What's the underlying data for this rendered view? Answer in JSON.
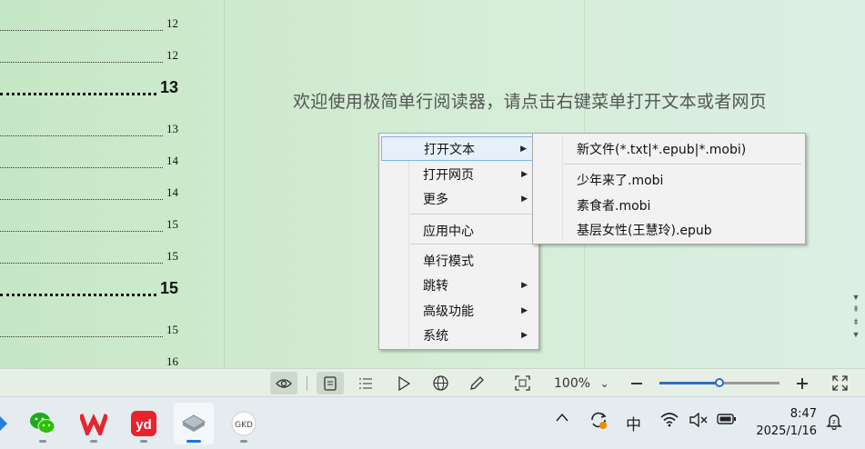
{
  "document": {
    "toc": [
      {
        "page": "12",
        "style": "small"
      },
      {
        "page": "12",
        "style": "small"
      },
      {
        "page": "13",
        "style": "big"
      },
      {
        "page": "13",
        "style": "small"
      },
      {
        "page": "14",
        "style": "small"
      },
      {
        "page": "14",
        "style": "small"
      },
      {
        "page": "15",
        "style": "small"
      },
      {
        "page": "15",
        "style": "small"
      },
      {
        "page": "15",
        "style": "big"
      },
      {
        "page": "15",
        "style": "small"
      },
      {
        "page": "16",
        "style": "small"
      }
    ],
    "welcome_text": "欢迎使用极简单行阅读器，请点击右键菜单打开文本或者网页"
  },
  "context_menu": {
    "items": [
      {
        "label": "打开文本",
        "submenu": true,
        "highlighted": true
      },
      {
        "label": "打开网页",
        "submenu": true
      },
      {
        "label": "更多",
        "submenu": true
      },
      {
        "label": "应用中心",
        "submenu": false
      },
      {
        "label": "单行模式",
        "submenu": false
      },
      {
        "label": "跳转",
        "submenu": true
      },
      {
        "label": "高级功能",
        "submenu": true
      },
      {
        "label": "系统",
        "submenu": true
      }
    ],
    "submenu_arrow": "▶"
  },
  "open_text_submenu": {
    "items": [
      {
        "label": "新文件(*.txt|*.epub|*.mobi)"
      },
      {
        "label": "少年来了.mobi"
      },
      {
        "label": "素食者.mobi"
      },
      {
        "label": "基层女性(王慧玲).epub"
      }
    ]
  },
  "toolbar": {
    "zoom_label": "100%",
    "zoom_dropdown_glyph": "⌄",
    "zoom_level": 0.5,
    "accent_color": "#2a6cc8"
  },
  "taskbar": {
    "apps": [
      "blue-app-icon",
      "wechat-icon",
      "wps-icon",
      "youdao-icon",
      "reader-app-icon",
      "gkd-app-icon"
    ],
    "ime_label": "中",
    "time": "8:47",
    "date": "2025/1/16"
  }
}
